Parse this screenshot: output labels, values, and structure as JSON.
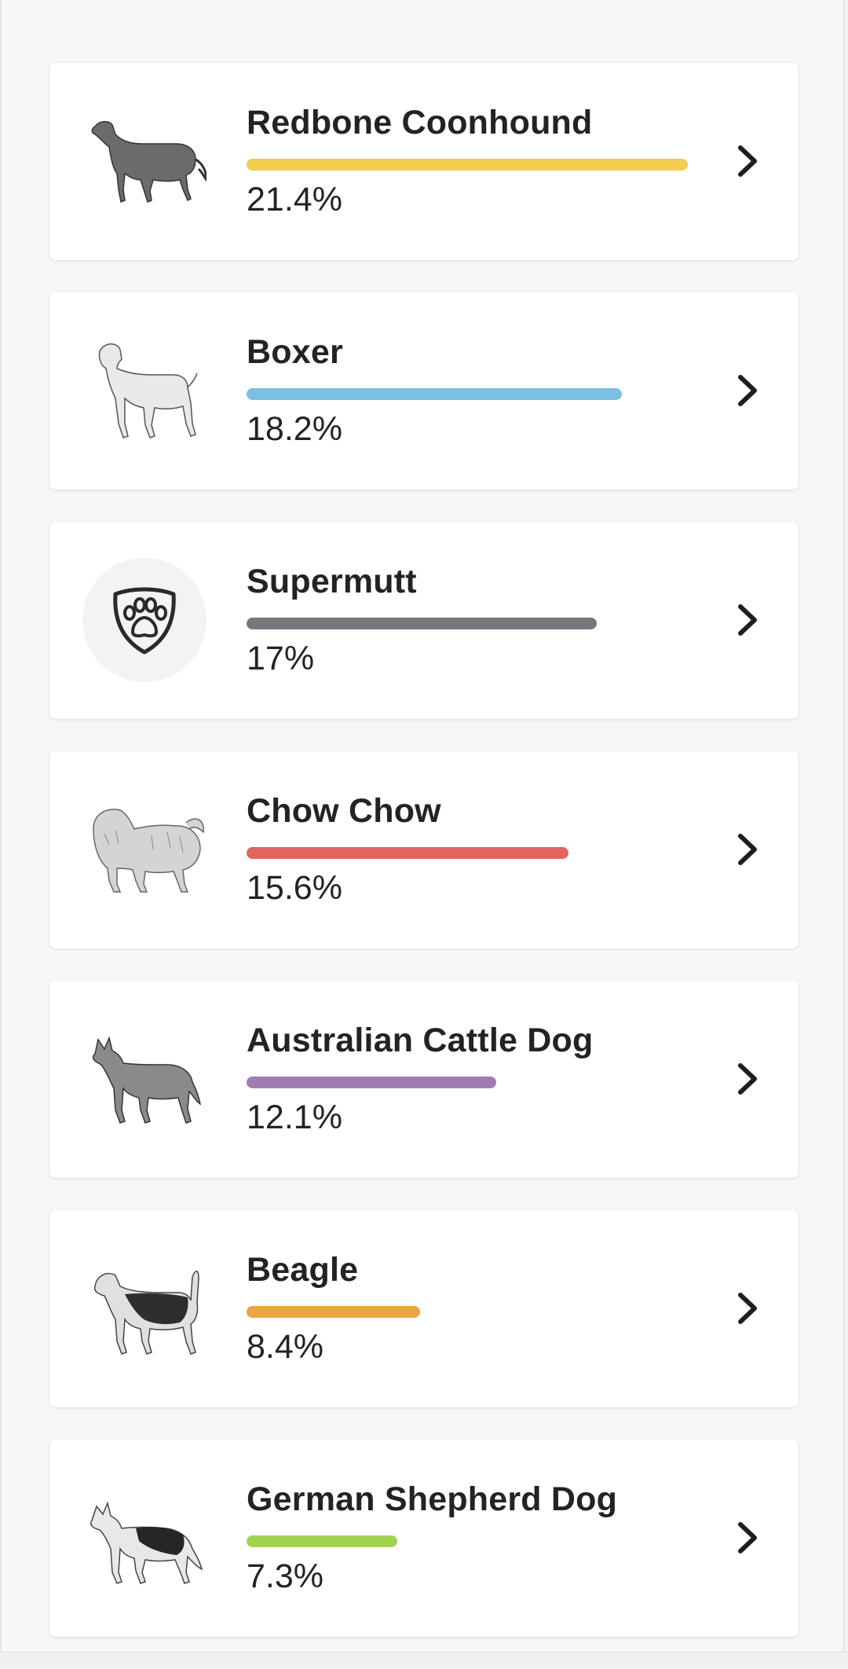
{
  "breeds": [
    {
      "name": "Redbone Coonhound",
      "percent_label": "21.4%",
      "percent": 21.4,
      "color": "#f2cd4f",
      "icon": "redbone-coonhound-illustration"
    },
    {
      "name": "Boxer",
      "percent_label": "18.2%",
      "percent": 18.2,
      "color": "#7bc0e3",
      "icon": "boxer-illustration"
    },
    {
      "name": "Supermutt",
      "percent_label": "17%",
      "percent": 17,
      "color": "#75777c",
      "icon": "paw-shield-icon"
    },
    {
      "name": "Chow Chow",
      "percent_label": "15.6%",
      "percent": 15.6,
      "color": "#e2635f",
      "icon": "chow-chow-illustration"
    },
    {
      "name": "Australian Cattle Dog",
      "percent_label": "12.1%",
      "percent": 12.1,
      "color": "#a07cb2",
      "icon": "australian-cattle-dog-illustration"
    },
    {
      "name": "Beagle",
      "percent_label": "8.4%",
      "percent": 8.4,
      "color": "#eda446",
      "icon": "beagle-illustration"
    },
    {
      "name": "German Shepherd Dog",
      "percent_label": "7.3%",
      "percent": 7.3,
      "color": "#a3d251",
      "icon": "german-shepherd-dog-illustration"
    }
  ]
}
